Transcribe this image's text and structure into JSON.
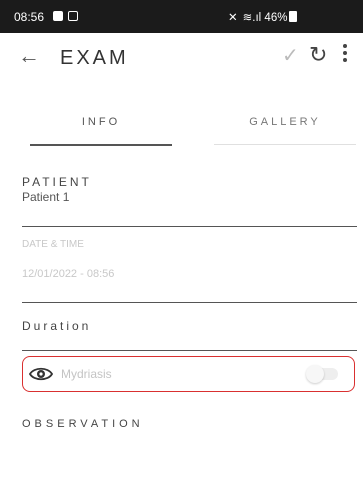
{
  "status_bar": {
    "time": "08:56",
    "right_text": "46%"
  },
  "app_bar": {
    "back_icon": "arrow-left-icon",
    "title": "EXAM",
    "check_icon": "check-icon",
    "refresh_icon": "refresh-icon",
    "menu_icon": "kebab-menu-icon"
  },
  "tabs": [
    {
      "label": "INFO",
      "selected": true
    },
    {
      "label": "GALLERY",
      "selected": false
    }
  ],
  "form": {
    "patient": {
      "label": "PATIENT",
      "value": "Patient 1"
    },
    "date_time": {
      "label": "DATE & TIME",
      "value": "12/01/2022 - 08:56"
    },
    "duration": {
      "label": "Duration",
      "value": ""
    },
    "mydriasis": {
      "label": "Mydriasis",
      "enabled": false,
      "icon": "eye-icon",
      "highlight_color": "#d93030"
    },
    "observation": {
      "label": "OBSERVATION"
    }
  }
}
